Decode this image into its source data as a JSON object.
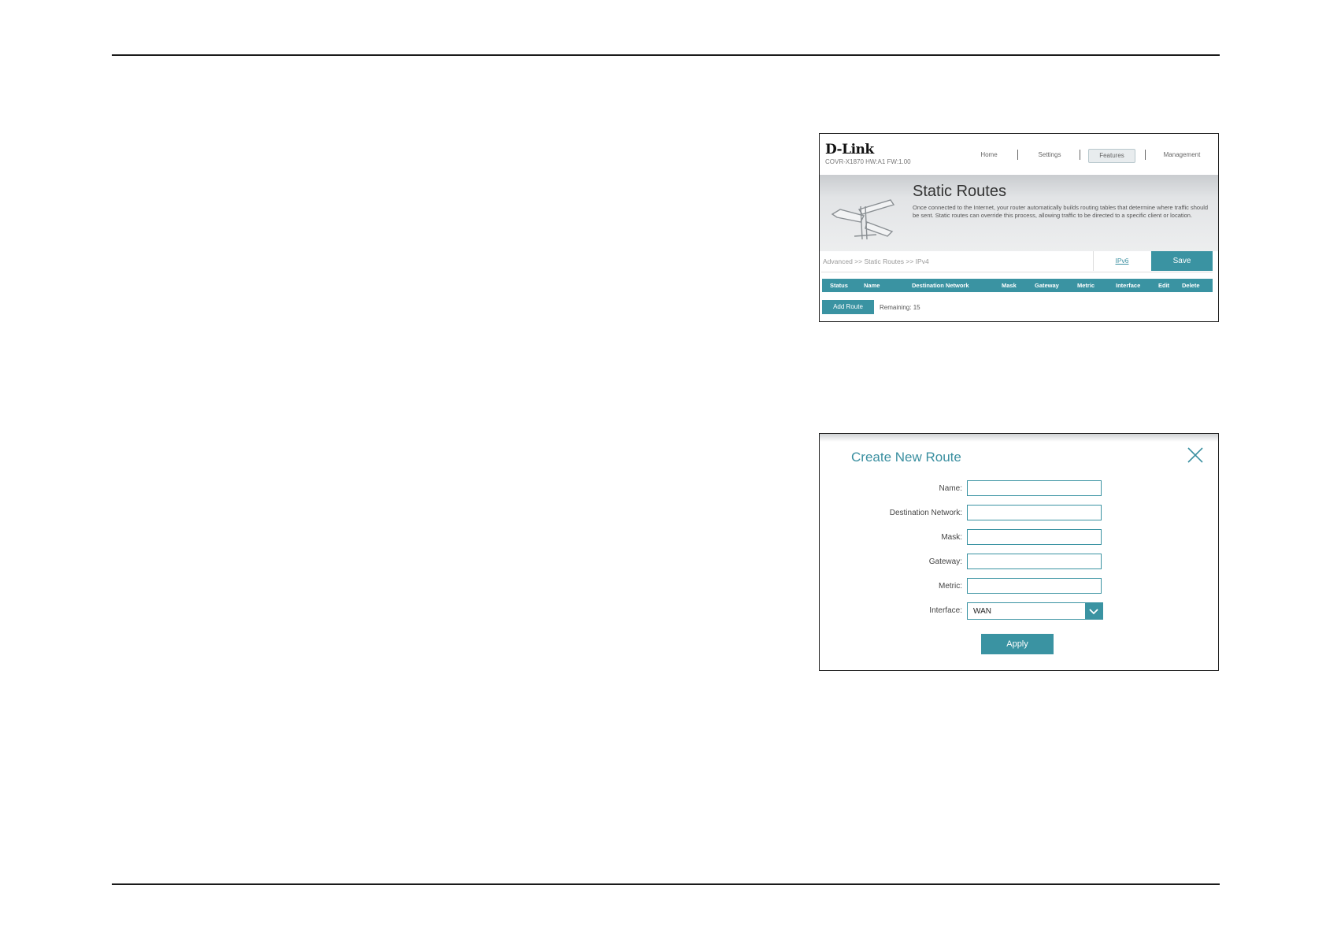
{
  "static_routes_screen": {
    "brand": "D-Link",
    "model_line": "COVR-X1870 HW:A1 FW:1.00",
    "nav": [
      {
        "label": "Home",
        "active": false
      },
      {
        "label": "Settings",
        "active": false
      },
      {
        "label": "Features",
        "active": true
      },
      {
        "label": "Management",
        "active": false
      }
    ],
    "title": "Static Routes",
    "description": "Once connected to the Internet, your router automatically builds routing tables that determine where traffic should be sent. Static routes can override this process, allowing traffic to be directed to a specific client or location.",
    "breadcrumb": "Advanced >> Static Routes >> IPv4",
    "ipv6_link": "IPv6",
    "save_label": "Save",
    "table_headers": [
      "Status",
      "Name",
      "Destination Network",
      "Mask",
      "Gateway",
      "Metric",
      "Interface",
      "Edit",
      "Delete"
    ],
    "add_route_label": "Add Route",
    "remaining_text": "Remaining: 15"
  },
  "create_route_dialog": {
    "title": "Create New Route",
    "fields": {
      "name": {
        "label": "Name:",
        "value": ""
      },
      "destination": {
        "label": "Destination Network:",
        "value": ""
      },
      "mask": {
        "label": "Mask:",
        "value": ""
      },
      "gateway": {
        "label": "Gateway:",
        "value": ""
      },
      "metric": {
        "label": "Metric:",
        "value": ""
      },
      "interface": {
        "label": "Interface:",
        "value": "WAN"
      }
    },
    "apply_label": "Apply"
  },
  "colors": {
    "accent": "#3a93a2",
    "title_teal": "#3a8fa0"
  }
}
